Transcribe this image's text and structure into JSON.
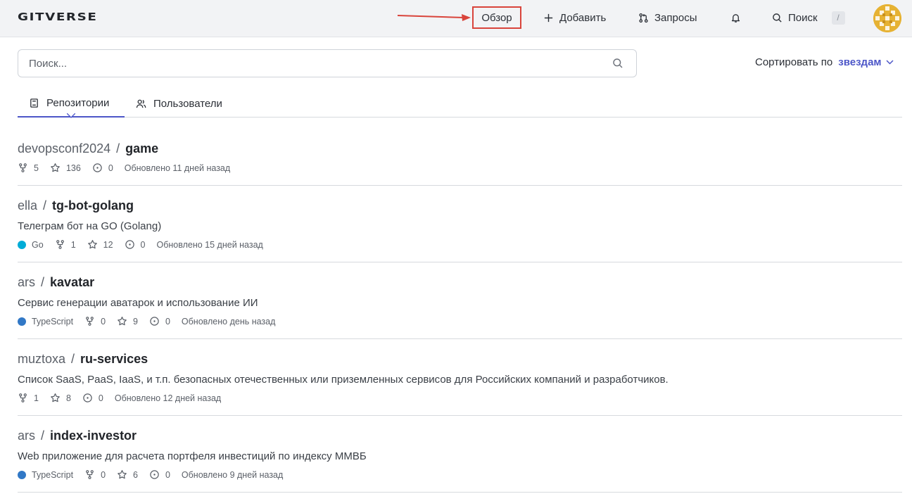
{
  "header": {
    "logo": "GITVERSE",
    "nav": {
      "overview": "Обзор",
      "add": "Добавить",
      "requests": "Запросы",
      "search": "Поиск",
      "search_shortcut": "/"
    },
    "annotation_arrow_color": "#d9443b"
  },
  "search": {
    "placeholder": "Поиск...",
    "value": ""
  },
  "sort": {
    "label": "Сортировать по",
    "value": "звездам"
  },
  "tabs": [
    {
      "label": "Репозитории",
      "active": true
    },
    {
      "label": "Пользователи",
      "active": false
    }
  ],
  "colors": {
    "accent": "#4c56c8",
    "go": "#00acd7",
    "typescript": "#3178c6",
    "highlight_box": "#d9443b"
  },
  "repos": [
    {
      "owner": "devopsconf2024",
      "name": "game",
      "description": "",
      "language": "",
      "forks": "5",
      "stars": "136",
      "issues": "0",
      "updated": "Обновлено 11 дней назад"
    },
    {
      "owner": "ella",
      "name": "tg-bot-golang",
      "description": "Телеграм бот на GO (Golang)",
      "language": "Go",
      "forks": "1",
      "stars": "12",
      "issues": "0",
      "updated": "Обновлено 15 дней назад"
    },
    {
      "owner": "ars",
      "name": "kavatar",
      "description": "Сервис генерации аватарок и использование ИИ",
      "language": "TypeScript",
      "forks": "0",
      "stars": "9",
      "issues": "0",
      "updated": "Обновлено день назад"
    },
    {
      "owner": "muztoxa",
      "name": "ru-services",
      "description": "Список SaaS, PaaS, IaaS, и т.п. безопасных отечественных или приземленных сервисов для Российских компаний и разработчиков.",
      "language": "",
      "forks": "1",
      "stars": "8",
      "issues": "0",
      "updated": "Обновлено 12 дней назад"
    },
    {
      "owner": "ars",
      "name": "index-investor",
      "description": "Web приложение для расчета портфеля инвестиций по индексу ММВБ",
      "language": "TypeScript",
      "forks": "0",
      "stars": "6",
      "issues": "0",
      "updated": "Обновлено 9 дней назад"
    }
  ]
}
